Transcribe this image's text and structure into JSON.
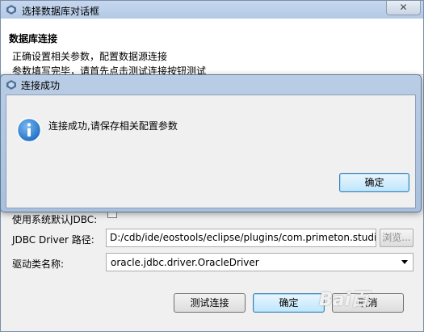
{
  "outer_dialog": {
    "title": "选择数据库对话框",
    "close_label": "✕",
    "header": {
      "title": "数据库连接",
      "line1": "正确设置相关参数，配置数据源连接",
      "line2": "参数填写完毕，请首先点击测试连接按钮测试"
    },
    "form": {
      "partial_label": "使用系统默认JDBC:",
      "jdbc_path_label": "JDBC Driver 路径:",
      "jdbc_path_value": "D:/cdb/ide/eostools/eclipse/plugins/com.primeton.studio",
      "browse_label": "浏览...",
      "driver_label": "驱动类名称:",
      "driver_value": "oracle.jdbc.driver.OracleDriver"
    },
    "buttons": {
      "test_label": "测试连接",
      "ok_label": "确定",
      "cancel_label": "取消"
    },
    "watermark": "Bai百"
  },
  "message_box": {
    "title": "连接成功",
    "message": "连接成功,请保存相关配置参数",
    "ok_label": "确定",
    "icon": "info-icon"
  },
  "colors": {
    "title_bar": "#b3c9e6",
    "dialog_bg": "#f0f0f0",
    "primary_button": "#bee6fd",
    "info_icon": "#1f6fc5"
  }
}
